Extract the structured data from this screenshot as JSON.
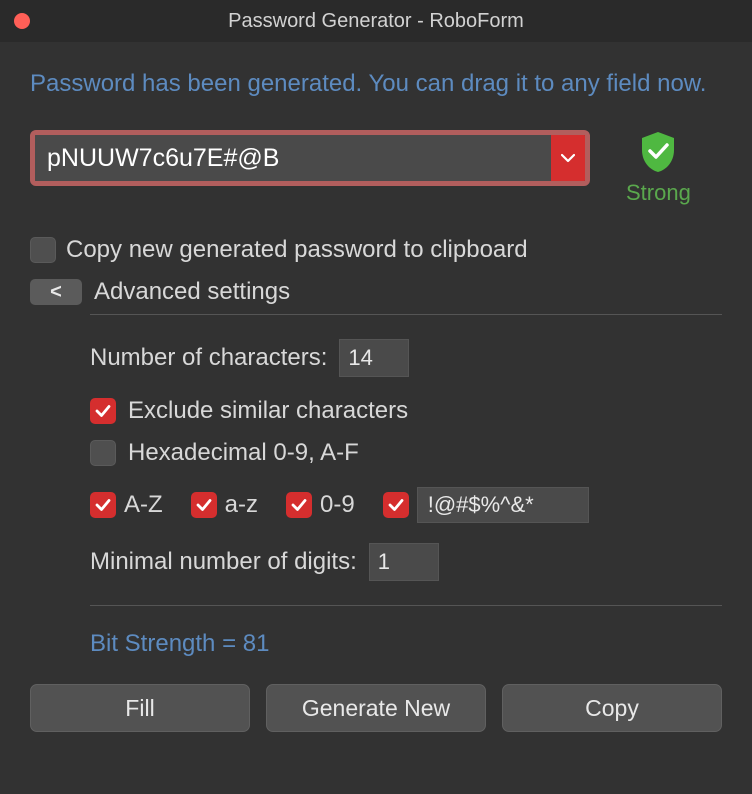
{
  "window": {
    "title": "Password Generator - RoboForm"
  },
  "info": "Password has been generated. You can drag it to any field now.",
  "password": {
    "value": "pNUUW7c6u7E#@B"
  },
  "strength": {
    "label": "Strong"
  },
  "copy_clipboard": {
    "label": "Copy new generated password to clipboard",
    "checked": false
  },
  "advanced": {
    "toggle_glyph": "<",
    "label": "Advanced settings",
    "num_chars": {
      "label": "Number of characters:",
      "value": "14"
    },
    "exclude_similar": {
      "label": "Exclude similar characters",
      "checked": true
    },
    "hex": {
      "label": "Hexadecimal 0-9, A-F",
      "checked": false
    },
    "sets": {
      "upper": {
        "label": "A-Z",
        "checked": true
      },
      "lower": {
        "label": "a-z",
        "checked": true
      },
      "digits": {
        "label": "0-9",
        "checked": true
      },
      "special": {
        "checked": true,
        "value": "!@#$%^&*"
      }
    },
    "min_digits": {
      "label": "Minimal number of digits:",
      "value": "1"
    }
  },
  "bit_strength": "Bit Strength = 81",
  "buttons": {
    "fill": "Fill",
    "generate": "Generate New",
    "copy": "Copy"
  }
}
